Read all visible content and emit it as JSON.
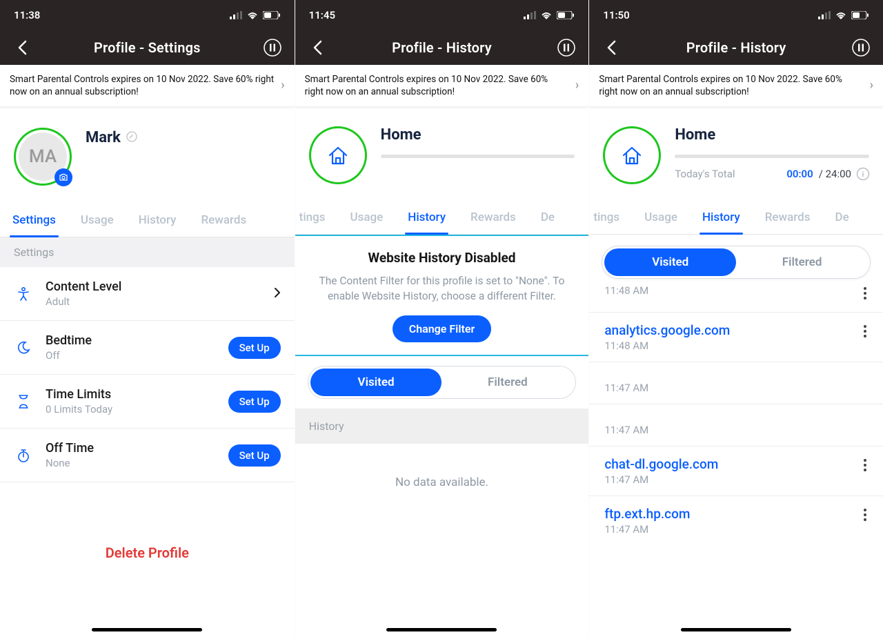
{
  "screens": [
    {
      "time": "11:38",
      "nav_title": "Profile - Settings",
      "promo": "Smart Parental Controls expires on 10 Nov 2022. Save 60% right now on an annual subscription!",
      "profile": {
        "initials": "MA",
        "name": "Mark"
      },
      "tabs": [
        "Settings",
        "Usage",
        "History",
        "Rewards"
      ],
      "active_tab": 0,
      "section_header": "Settings",
      "settings": [
        {
          "title": "Content Level",
          "sub": "Adult",
          "action": "chevron"
        },
        {
          "title": "Bedtime",
          "sub": "Off",
          "action": "Set Up"
        },
        {
          "title": "Time Limits",
          "sub": "0 Limits Today",
          "action": "Set Up"
        },
        {
          "title": "Off Time",
          "sub": "None",
          "action": "Set Up"
        }
      ],
      "delete_label": "Delete Profile"
    },
    {
      "time": "11:45",
      "nav_title": "Profile - History",
      "promo": "Smart Parental Controls expires on 10 Nov 2022. Save 60% right now on an annual subscription!",
      "home_title": "Home",
      "tabs_shifted": [
        "tings",
        "Usage",
        "History",
        "Rewards",
        "De"
      ],
      "active_tab": 2,
      "disabled": {
        "title": "Website History Disabled",
        "sub": "The Content Filter for this profile is set to \"None\". To enable Website History, choose a different Filter.",
        "button": "Change Filter"
      },
      "segmented": {
        "visited": "Visited",
        "filtered": "Filtered",
        "active": 0
      },
      "history_label": "History",
      "no_data": "No data available."
    },
    {
      "time": "11:50",
      "nav_title": "Profile - History",
      "promo": "Smart Parental Controls expires on 10 Nov 2022. Save 60% right now on an annual subscription!",
      "home_title": "Home",
      "totals": {
        "label": "Today's Total",
        "used": "00:00",
        "of": "/ 24:00"
      },
      "tabs_shifted": [
        "tings",
        "Usage",
        "History",
        "Rewards",
        "De"
      ],
      "active_tab": 2,
      "segmented": {
        "visited": "Visited",
        "filtered": "Filtered",
        "active": 0
      },
      "history": [
        {
          "partial_top_time": "11:48 AM"
        },
        {
          "domain": "analytics.google.com",
          "time": "11:48 AM",
          "menu": true
        },
        {
          "domain": "",
          "time": "11:47 AM",
          "menu": false
        },
        {
          "domain": "",
          "time": "11:47 AM",
          "menu": false
        },
        {
          "domain": "chat-dl.google.com",
          "time": "11:47 AM",
          "menu": true
        },
        {
          "domain": "ftp.ext.hp.com",
          "time": "11:47 AM",
          "menu": true
        }
      ]
    }
  ]
}
